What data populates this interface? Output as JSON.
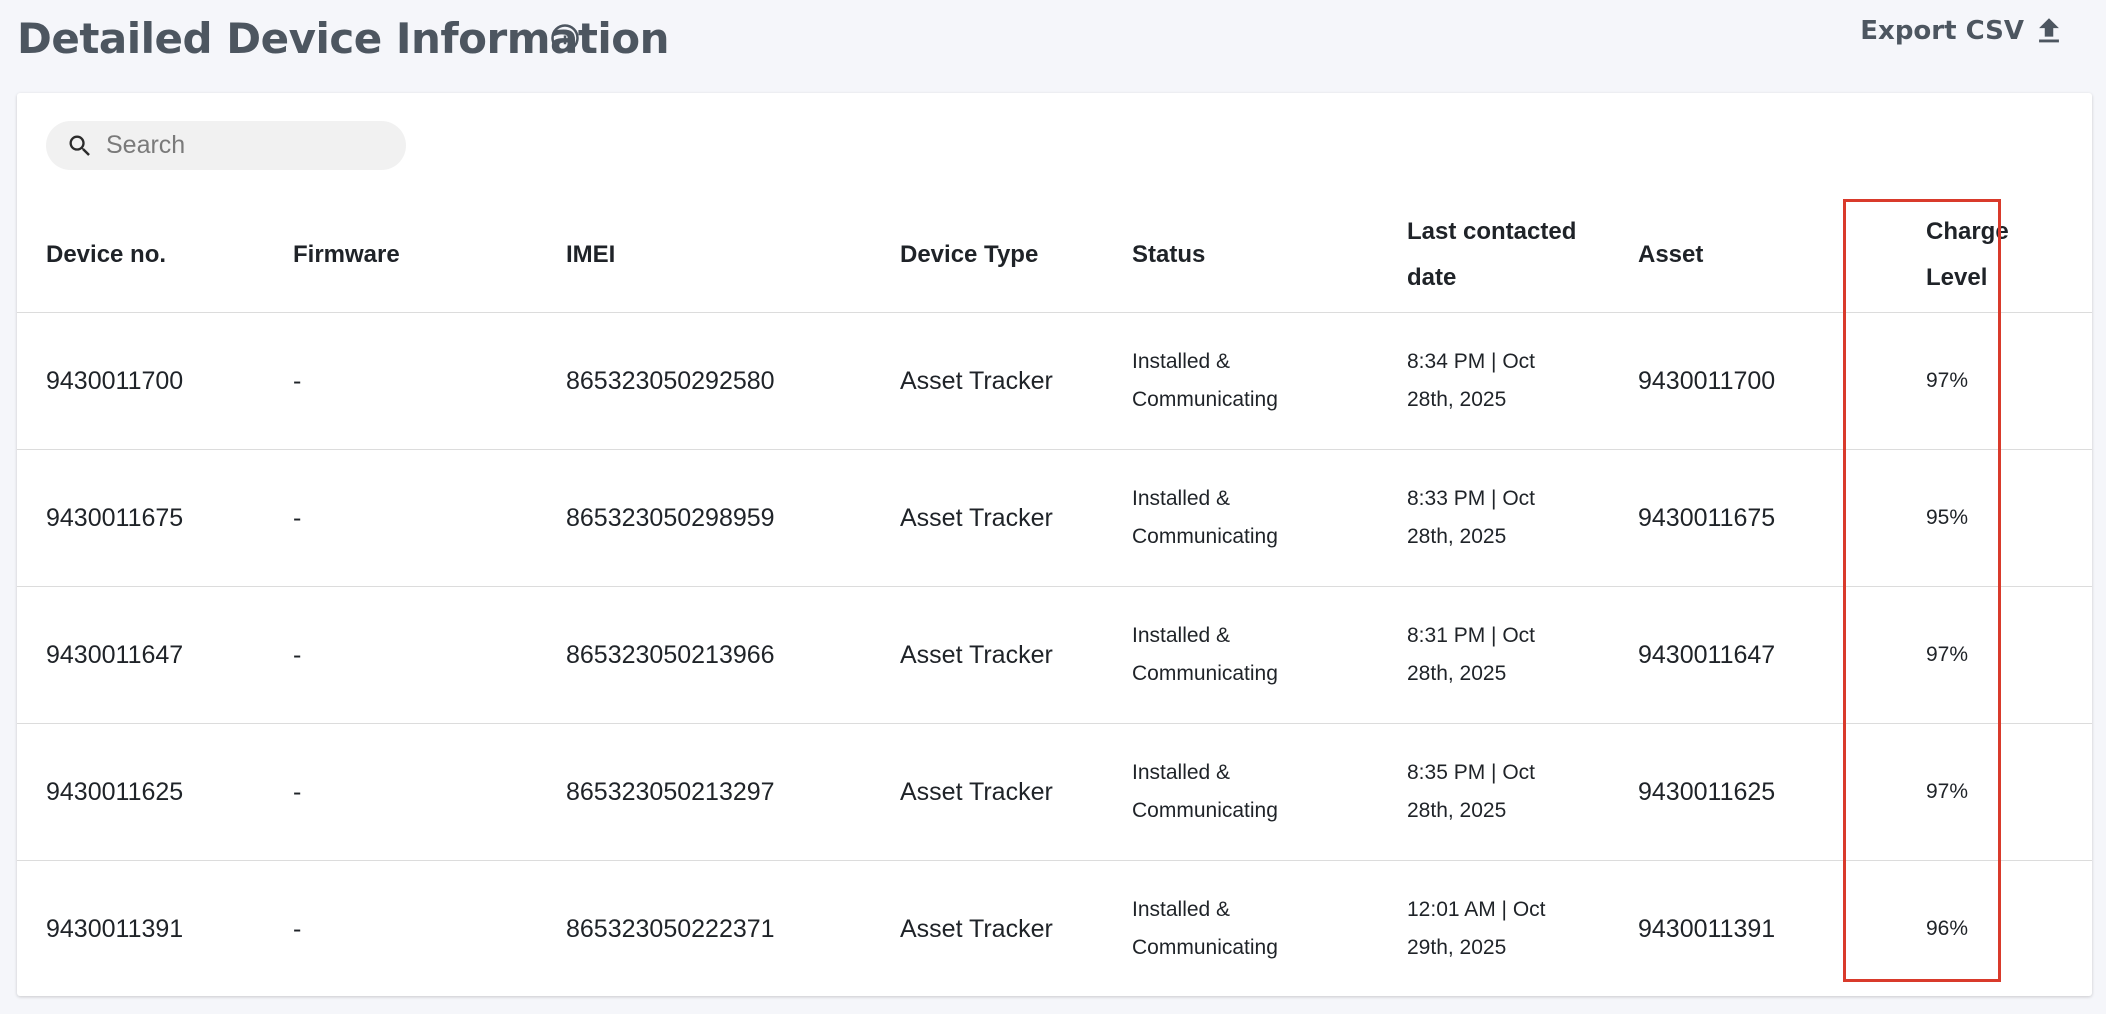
{
  "header": {
    "title": "Detailed Device Information",
    "export_label": "Export CSV"
  },
  "search": {
    "placeholder": "Search",
    "value": ""
  },
  "table": {
    "columns": [
      "Device no.",
      "Firmware",
      "IMEI",
      "Device Type",
      "Status",
      "Last contacted date",
      "Asset",
      "Charge Level"
    ],
    "rows": [
      {
        "device_no": "9430011700",
        "firmware": "-",
        "imei": "865323050292580",
        "device_type": "Asset Tracker",
        "status": "Installed & Communicating",
        "last_contacted": "8:34 PM | Oct 28th, 2025",
        "asset": "9430011700",
        "charge_level": "97%"
      },
      {
        "device_no": "9430011675",
        "firmware": "-",
        "imei": "865323050298959",
        "device_type": "Asset Tracker",
        "status": "Installed & Communicating",
        "last_contacted": "8:33 PM | Oct 28th, 2025",
        "asset": "9430011675",
        "charge_level": "95%"
      },
      {
        "device_no": "9430011647",
        "firmware": "-",
        "imei": "865323050213966",
        "device_type": "Asset Tracker",
        "status": "Installed & Communicating",
        "last_contacted": "8:31 PM | Oct 28th, 2025",
        "asset": "9430011647",
        "charge_level": "97%"
      },
      {
        "device_no": "9430011625",
        "firmware": "-",
        "imei": "865323050213297",
        "device_type": "Asset Tracker",
        "status": "Installed & Communicating",
        "last_contacted": "8:35 PM | Oct 28th, 2025",
        "asset": "9430011625",
        "charge_level": "97%"
      },
      {
        "device_no": "9430011391",
        "firmware": "-",
        "imei": "865323050222371",
        "device_type": "Asset Tracker",
        "status": "Installed & Communicating",
        "last_contacted": "12:01 AM | Oct 29th, 2025",
        "asset": "9430011391",
        "charge_level": "96%"
      }
    ]
  },
  "colors": {
    "highlight": "#d93a2b",
    "title": "#4d5660",
    "background": "#f5f6fa"
  },
  "icons": {
    "info": "info-icon",
    "export": "upload-icon",
    "search": "search-icon"
  }
}
